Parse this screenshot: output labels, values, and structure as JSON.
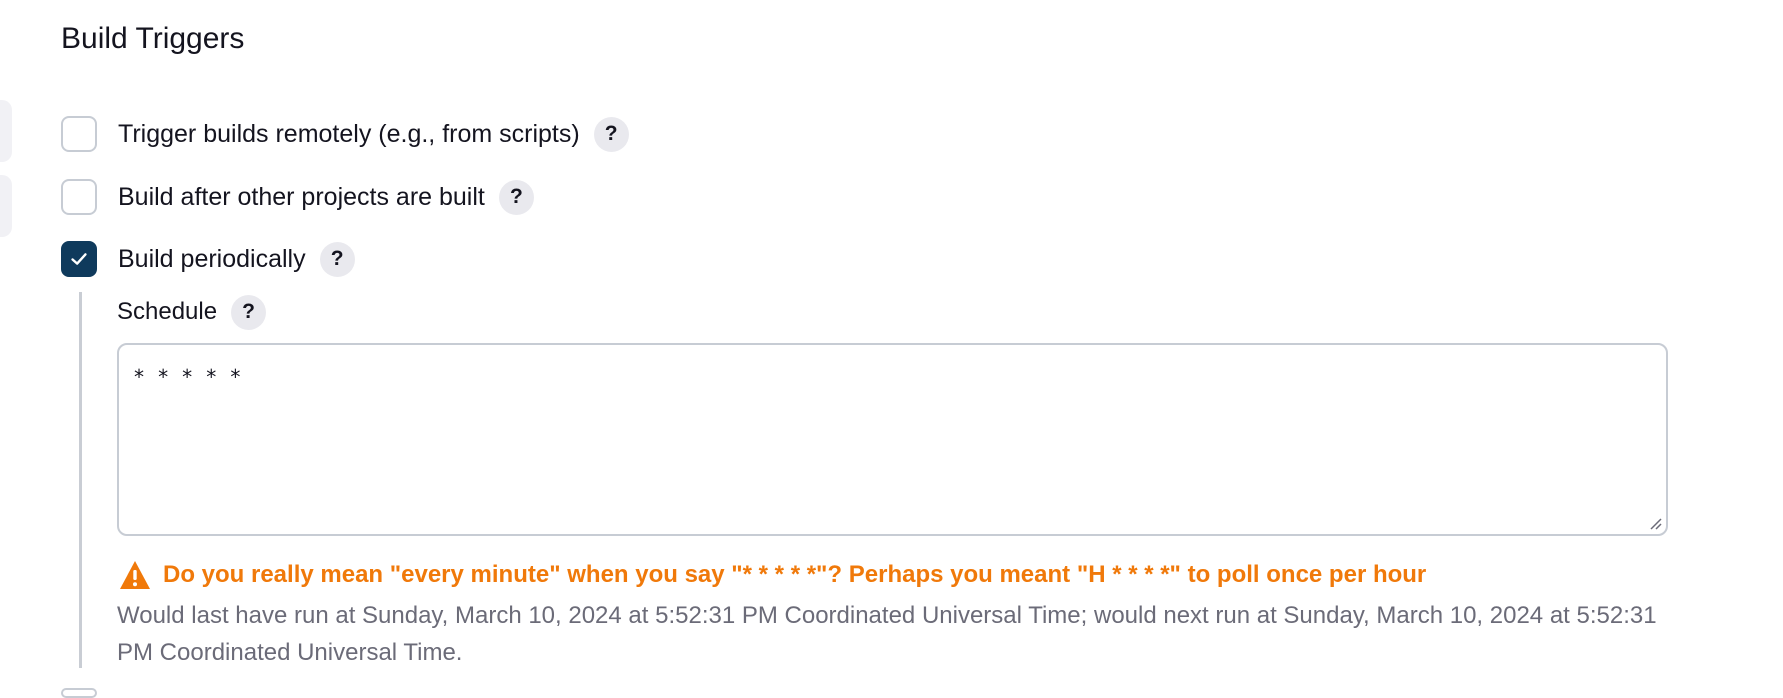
{
  "section": {
    "title": "Build Triggers"
  },
  "triggers": [
    {
      "label": "Trigger builds remotely (e.g., from scripts)",
      "checked": false,
      "help": "?"
    },
    {
      "label": "Build after other projects are built",
      "checked": false,
      "help": "?"
    },
    {
      "label": "Build periodically",
      "checked": true,
      "help": "?"
    }
  ],
  "schedule": {
    "label": "Schedule",
    "help": "?",
    "value": "* * * * *",
    "warning": "Do you really mean \"every minute\" when you say \"* * * * *\"? Perhaps you meant \"H * * * *\" to poll once per hour",
    "info": "Would last have run at Sunday, March 10, 2024 at 5:52:31 PM Coordinated Universal Time; would next run at Sunday, March 10, 2024 at 5:52:31 PM Coordinated Universal Time."
  },
  "colors": {
    "checkbox_checked": "#0f3a5c",
    "warning": "#f0790a",
    "muted_text": "#6b6b78"
  },
  "icons": {
    "help": "question-mark-icon",
    "check": "checkmark-icon",
    "warning": "warning-triangle-icon"
  }
}
